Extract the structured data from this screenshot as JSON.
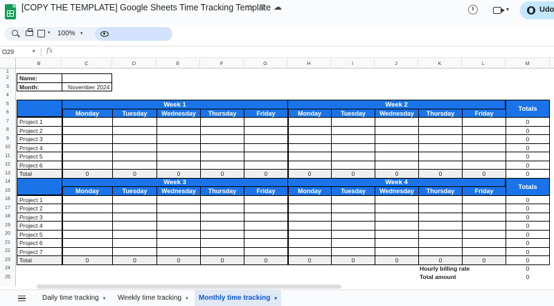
{
  "app": {
    "doc_title": "[COPY THE TEMPLATE] Google Sheets Time Tracking Template",
    "star_icon": "star-icon",
    "move_icon": "move-to-drive-icon",
    "cloud_icon": "cloud-status-icon",
    "share_label": "Udos"
  },
  "toolbar": {
    "zoom": "100%",
    "caret": "▾"
  },
  "formula_bar": {
    "cell_ref": "O29",
    "fx": "fx"
  },
  "grid": {
    "columns": [
      "B",
      "C",
      "D",
      "E",
      "F",
      "G",
      "H",
      "I",
      "J",
      "K",
      "L",
      "M"
    ],
    "rows": [
      "1",
      "2",
      "3",
      "4",
      "5",
      "6",
      "7",
      "8",
      "9",
      "10",
      "11",
      "12",
      "13",
      "14",
      "15",
      "16",
      "17",
      "18",
      "19",
      "20",
      "21",
      "22",
      "23",
      "24",
      "25"
    ]
  },
  "info": {
    "name_label": "Name:",
    "name_value": "",
    "month_label": "Month:",
    "month_value": "November 2024"
  },
  "days": [
    "Monday",
    "Tuesday",
    "Wednesday",
    "Thursday",
    "Friday"
  ],
  "totals_label": "Totals",
  "block1": {
    "week_a": "Week 1",
    "week_b": "Week 2",
    "projects": [
      "Project 1",
      "Project 2",
      "Project 3",
      "Project 4",
      "Project 5",
      "Project 6"
    ],
    "row_totals": [
      "0",
      "0",
      "0",
      "0",
      "0",
      "0"
    ],
    "total_label": "Total",
    "total_values": [
      "0",
      "0",
      "0",
      "0",
      "0",
      "0",
      "0",
      "0",
      "0",
      "0"
    ],
    "grand_total": "0"
  },
  "block2": {
    "week_a": "Week 3",
    "week_b": "Week 4",
    "projects": [
      "Project 1",
      "Project 2",
      "Project 3",
      "Project 4",
      "Project 5",
      "Project 6",
      "Project 7"
    ],
    "row_totals": [
      "0",
      "0",
      "0",
      "0",
      "0",
      "0",
      "0"
    ],
    "total_label": "Total",
    "total_values": [
      "0",
      "0",
      "0",
      "0",
      "0",
      "0",
      "0",
      "0",
      "0",
      "0"
    ],
    "grand_total": "0"
  },
  "billing": {
    "rate_label": "Hourly billing rate",
    "rate_value": "0",
    "amount_label": "Total amount",
    "amount_value": "0"
  },
  "tabs": [
    {
      "label": "Daily time tracking",
      "caret": "▾",
      "active": false
    },
    {
      "label": "Weekly time tracking",
      "caret": "▾",
      "active": false
    },
    {
      "label": "Monthly time tracking",
      "caret": "▾",
      "active": true
    }
  ],
  "colors": {
    "header_blue": "#1a73e8",
    "sheets_green": "#0f9d58",
    "active_tab_text": "#0b57d0"
  }
}
